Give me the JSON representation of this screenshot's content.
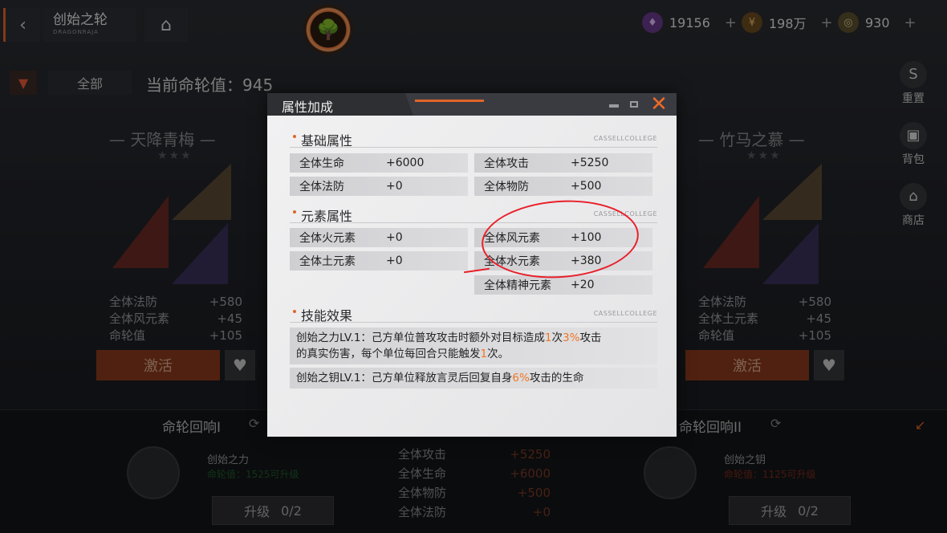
{
  "header": {
    "back_icon": "chevron-left-icon",
    "title": "创始之轮",
    "subtitle": "DRAGONRAJA",
    "home_icon": "home-icon",
    "emblem_icon": "tree-emblem-icon"
  },
  "currencies": [
    {
      "icon": "purple-gem-icon",
      "value": "19156",
      "plus": "+"
    },
    {
      "icon": "gold-coin-icon",
      "value": "198万",
      "plus": "+"
    },
    {
      "icon": "medal-icon",
      "value": "930",
      "plus": "+"
    }
  ],
  "filter": {
    "label": "全部"
  },
  "current_value": "当前命轮值：945",
  "side_menu": [
    {
      "label": "重置",
      "icon": "reset-icon"
    },
    {
      "label": "背包",
      "icon": "backpack-icon"
    },
    {
      "label": "商店",
      "icon": "shop-icon"
    }
  ],
  "left_panel": {
    "title": "— 天降青梅 —",
    "stars": "★★★",
    "stats": [
      {
        "name": "全体法防",
        "value": "+580"
      },
      {
        "name": "全体风元素",
        "value": "+45"
      },
      {
        "name": "命轮值",
        "value": "+105"
      }
    ],
    "activate": "激活"
  },
  "right_panel": {
    "title": "— 竹马之慕 —",
    "stars": "★★★",
    "stats": [
      {
        "name": "全体法防",
        "value": "+580"
      },
      {
        "name": "全体土元素",
        "value": "+45"
      },
      {
        "name": "命轮值",
        "value": "+105"
      }
    ],
    "activate": "激活"
  },
  "echoes": [
    {
      "title": "命轮回响I",
      "name": "创始之力",
      "req": "命轮值：1525可升级",
      "upgrade": "升级",
      "progress": "0/2"
    },
    {
      "title": "命轮回响II",
      "name": "创始之钥",
      "req": "命轮值：1125可升级",
      "upgrade": "升级",
      "progress": "0/2"
    }
  ],
  "mid_stats": [
    {
      "name": "全体攻击",
      "value": "+5250"
    },
    {
      "name": "全体生命",
      "value": "+6000"
    },
    {
      "name": "全体物防",
      "value": "+500"
    },
    {
      "name": "全体法防",
      "value": "+0"
    }
  ],
  "modal": {
    "title": "属性加成",
    "close_icon": "close-icon",
    "brand": "CASSELLCOLLEGE",
    "sections": {
      "basic": {
        "label": "基础属性",
        "stats": [
          {
            "name": "全体生命",
            "value": "+6000"
          },
          {
            "name": "全体攻击",
            "value": "+5250"
          },
          {
            "name": "全体法防",
            "value": "+0"
          },
          {
            "name": "全体物防",
            "value": "+500"
          }
        ]
      },
      "element": {
        "label": "元素属性",
        "stats": [
          {
            "name": "全体火元素",
            "value": "+0"
          },
          {
            "name": "全体风元素",
            "value": "+100"
          },
          {
            "name": "全体土元素",
            "value": "+0"
          },
          {
            "name": "全体水元素",
            "value": "+380"
          },
          {
            "name": "全体精神元素",
            "value": "+20"
          }
        ]
      },
      "skill": {
        "label": "技能效果",
        "rows": [
          {
            "a": "创始之力LV.1：己方单位普攻攻击时额外对目标造成",
            "h1": "1",
            "b": "次",
            "h2": "3%",
            "c": "攻击",
            "d": "的真实伤害，每个单位每回合只能触发",
            "h3": "1",
            "e": "次。"
          },
          {
            "a": "创始之钥LV.1：己方单位释放言灵后回复自身",
            "h1": "6%",
            "b": "攻击的生命"
          }
        ]
      }
    }
  },
  "colors": {
    "accent": "#e0652b",
    "highlight": "#f07522",
    "annotation": "#e8202a"
  }
}
